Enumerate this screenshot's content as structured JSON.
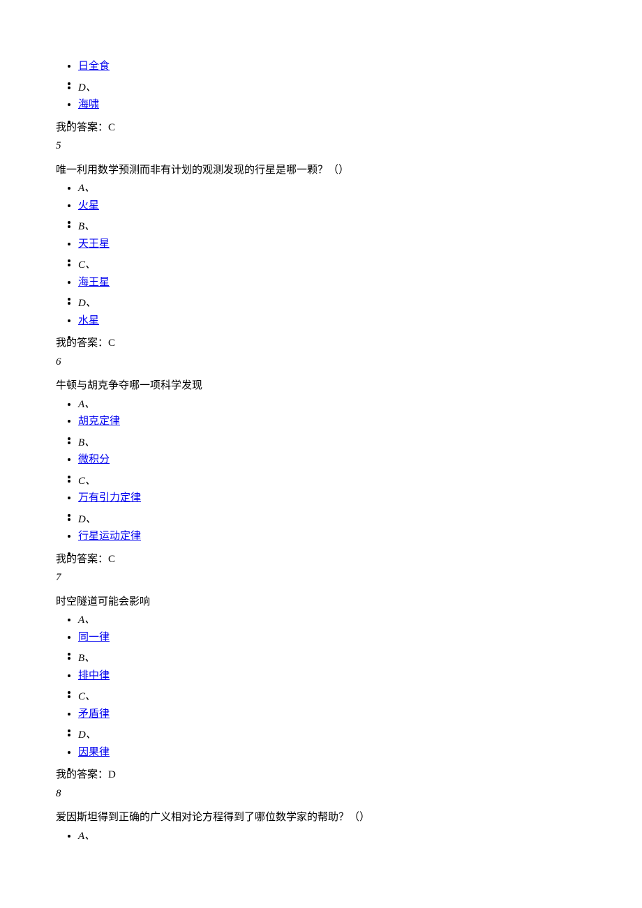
{
  "top_options": {
    "opt_c": "日全食",
    "letter_d": "D、",
    "opt_d": "海啸"
  },
  "top_answer": "我的答案：C",
  "q5": {
    "num": "5",
    "text": "唯一利用数学预测而非有计划的观测发现的行星是哪一颗？（）",
    "letter_a": "A、",
    "opt_a": "火星",
    "letter_b": "B、",
    "opt_b": "天王星",
    "letter_c": "C、",
    "opt_c": "海王星",
    "letter_d": "D、",
    "opt_d": "水星",
    "answer": "我的答案：C"
  },
  "q6": {
    "num": "6",
    "text": "牛顿与胡克争夺哪一项科学发现",
    "letter_a": "A、",
    "opt_a": "胡克定律",
    "letter_b": "B、",
    "opt_b": "微积分",
    "letter_c": "C、",
    "opt_c": "万有引力定律",
    "letter_d": "D、",
    "opt_d": "行星运动定律",
    "answer": "我的答案：C"
  },
  "q7": {
    "num": "7",
    "text": "时空隧道可能会影响",
    "letter_a": "A、",
    "opt_a": "同一律",
    "letter_b": "B、",
    "opt_b": "排中律",
    "letter_c": "C、",
    "opt_c": "矛盾律",
    "letter_d": "D、",
    "opt_d": "因果律",
    "answer": "我的答案：D"
  },
  "q8": {
    "num": "8",
    "text": "爱因斯坦得到正确的广义相对论方程得到了哪位数学家的帮助？（）",
    "letter_a": "A、"
  }
}
